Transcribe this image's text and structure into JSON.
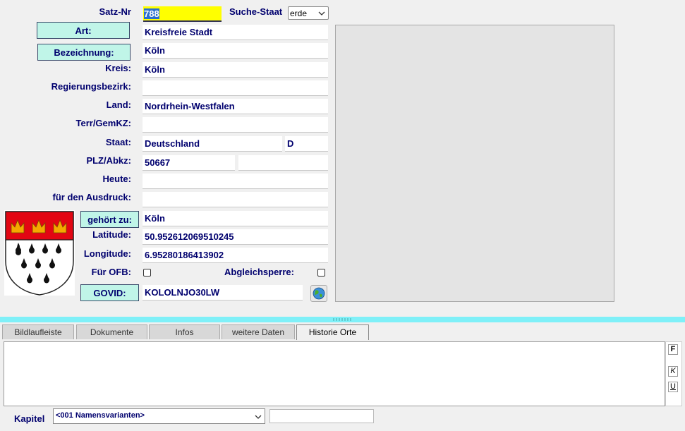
{
  "labels": {
    "satz_nr": "Satz-Nr",
    "suche_staat": "Suche-Staat",
    "kreis": "Kreis:",
    "regierungsbezirk": "Regierungsbezirk:",
    "land": "Land:",
    "terr_gemkz": "Terr/GemKZ:",
    "staat": "Staat:",
    "plz_abkz": "PLZ/Abkz:",
    "heute": "Heute:",
    "fuer_den_ausdruck": "für den Ausdruck:",
    "latitude": "Latitude:",
    "longitude": "Longitude:",
    "fuer_ofb": "Für OFB:",
    "abgleichsperre": "Abgleichsperre:",
    "kapitel": "Kapitel"
  },
  "buttons": {
    "art": "Art:",
    "bezeichnung": "Bezeichnung:",
    "gehoert_zu": "gehört zu:",
    "govid": "GOVID:"
  },
  "fields": {
    "satz_nr": "788",
    "suche_staat": "erde",
    "art": "Kreisfreie Stadt",
    "bezeichnung": "Köln",
    "kreis": "Köln",
    "regierungsbezirk": "",
    "land": "Nordrhein-Westfalen",
    "terr_gemkz": "",
    "staat": "Deutschland",
    "staat_code": "D",
    "plz": "50667",
    "abkz": "",
    "heute": "",
    "fuer_den_ausdruck": "",
    "gehoert_zu": "Köln",
    "latitude": "50.952612069510245",
    "longitude": "6.95280186413902",
    "govid": "KOLOLNJO30LW",
    "kapitel": "<001 Namensvarianten>",
    "kapitel_extra": ""
  },
  "checkboxes": {
    "fuer_ofb": false,
    "abgleichsperre": false
  },
  "tabs": [
    {
      "label": "Bildlaufleiste",
      "active": false
    },
    {
      "label": "Dokumente",
      "active": false
    },
    {
      "label": "Infos",
      "active": false
    },
    {
      "label": "weitere Daten",
      "active": false
    },
    {
      "label": "Historie Orte",
      "active": true
    }
  ],
  "format_buttons": {
    "bold": "F",
    "italic": "K",
    "underline": "U"
  },
  "icons": {
    "coat_of_arms": "cologne-coat-of-arms-icon",
    "globe": "globe-icon",
    "dropdown": "chevron-down-icon",
    "splitter": "splitter-grip-icon"
  },
  "colors": {
    "label_text": "#00006e",
    "button_bg": "#c0f5e8",
    "highlight_field": "#ffff00",
    "splitter": "#7ff0f8",
    "coat_red": "#e30613",
    "coat_gold": "#f5a800"
  }
}
